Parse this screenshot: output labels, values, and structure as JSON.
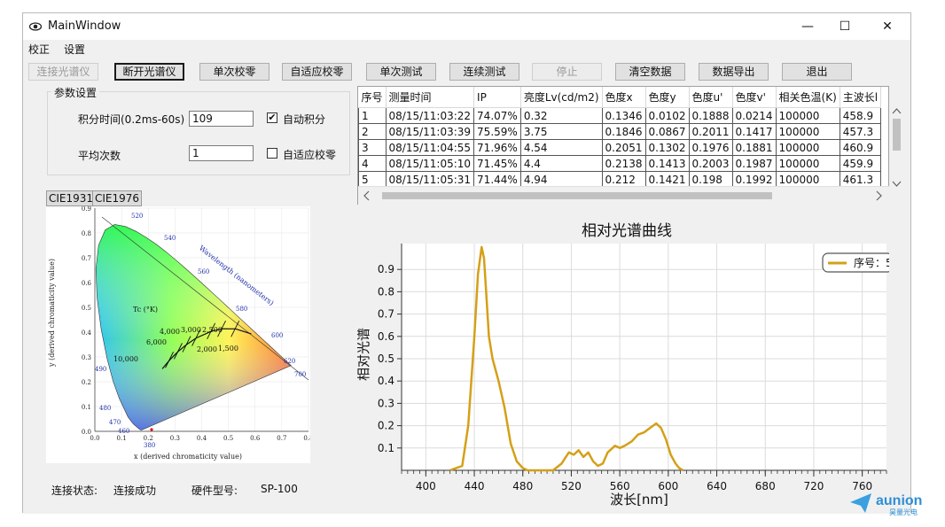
{
  "window": {
    "title": "MainWindow",
    "controls": {
      "minimize": "—",
      "maximize": "☐",
      "close": "✕"
    }
  },
  "menu": [
    "校正",
    "设置"
  ],
  "toolbar": [
    {
      "label": "连接光谱仪",
      "state": "disabled"
    },
    {
      "label": "断开光谱仪",
      "state": "primary"
    },
    {
      "label": "单次校零",
      "state": "normal"
    },
    {
      "label": "自适应校零",
      "state": "normal"
    },
    {
      "label": "单次测试",
      "state": "normal"
    },
    {
      "label": "连续测试",
      "state": "normal"
    },
    {
      "label": "停止",
      "state": "disabled"
    },
    {
      "label": "清空数据",
      "state": "normal"
    },
    {
      "label": "数据导出",
      "state": "normal"
    },
    {
      "label": "退出",
      "state": "normal"
    }
  ],
  "params": {
    "group_title": "参数设置",
    "integration_label": "积分时间(0.2ms-60s)",
    "integration_value": "109",
    "auto_integration_label": "自动积分",
    "auto_integration_checked": true,
    "average_label": "平均次数",
    "average_value": "1",
    "adaptive_zero_label": "自适应校零",
    "adaptive_zero_checked": false
  },
  "cie_tabs": [
    "CIE1931",
    "CIE1976"
  ],
  "cie_chart": {
    "ylabel": "y (derived chromaticity value)",
    "xlabel": "x (derived chromaticity value)",
    "x_ticks": [
      "0.0",
      "0.1",
      "0.2",
      "0.3",
      "0.4",
      "0.5",
      "0.6",
      "0.7",
      "0.8"
    ],
    "y_ticks": [
      "0.0",
      "0.1",
      "0.2",
      "0.3",
      "0.4",
      "0.5",
      "0.6",
      "0.7",
      "0.8",
      "0.9"
    ],
    "wavelength_label": "Wavelength (nanometers)",
    "tc_label": "Tc (°K)",
    "locus_labels": [
      "520",
      "540",
      "560",
      "580",
      "600",
      "620",
      "700",
      "490",
      "480",
      "470",
      "460",
      "380"
    ],
    "cct_labels": [
      "10,000",
      "6,000",
      "4,000",
      "3,000",
      "2,500",
      "2,000",
      "1,500"
    ]
  },
  "table": {
    "columns": [
      "序号",
      "测量时间",
      "IP",
      "亮度Lv(cd/m2)",
      "色度x",
      "色度y",
      "色度u'",
      "色度v'",
      "相关色温(K)",
      "主波长l"
    ],
    "rows": [
      [
        "1",
        "08/15/11:03:22",
        "74.07%",
        "0.32",
        "0.1346",
        "0.0102",
        "0.1888",
        "0.0214",
        "100000",
        "458.9"
      ],
      [
        "2",
        "08/15/11:03:39",
        "75.59%",
        "3.75",
        "0.1846",
        "0.0867",
        "0.2011",
        "0.1417",
        "100000",
        "457.3"
      ],
      [
        "3",
        "08/15/11:04:55",
        "71.96%",
        "4.54",
        "0.2051",
        "0.1302",
        "0.1976",
        "0.1881",
        "100000",
        "460.9"
      ],
      [
        "4",
        "08/15/11:05:10",
        "71.45%",
        "4.4",
        "0.2138",
        "0.1413",
        "0.2003",
        "0.1987",
        "100000",
        "459.9"
      ],
      [
        "5",
        "08/15/11:05:31",
        "71.44%",
        "4.94",
        "0.212",
        "0.1421",
        "0.198",
        "0.1992",
        "100000",
        "461.3"
      ]
    ]
  },
  "chart_data": {
    "type": "line",
    "title": "相对光谱曲线",
    "xlabel": "波长[nm]",
    "ylabel": "相对光谱",
    "xlim": [
      380,
      780
    ],
    "ylim": [
      0,
      1.0
    ],
    "x_ticks": [
      400,
      440,
      480,
      520,
      560,
      600,
      640,
      680,
      720,
      760
    ],
    "y_ticks": [
      0.1,
      0.2,
      0.3,
      0.4,
      0.5,
      0.6,
      0.7,
      0.8,
      0.9
    ],
    "legend": "top-right",
    "grid": true,
    "color": "#d4a017",
    "series": [
      {
        "name": "序号：5",
        "x": [
          420,
          430,
          435,
          440,
          443,
          446,
          448,
          450,
          452,
          455,
          460,
          465,
          470,
          475,
          480,
          484,
          487,
          505,
          512,
          518,
          522,
          526,
          530,
          534,
          538,
          542,
          546,
          550,
          556,
          560,
          564,
          570,
          575,
          580,
          585,
          590,
          594,
          598,
          602,
          606,
          609,
          612
        ],
        "y": [
          0,
          0.02,
          0.2,
          0.6,
          0.88,
          1.0,
          0.95,
          0.78,
          0.6,
          0.5,
          0.4,
          0.28,
          0.12,
          0.04,
          0.01,
          0,
          0,
          0,
          0.03,
          0.08,
          0.07,
          0.09,
          0.06,
          0.08,
          0.04,
          0.02,
          0.03,
          0.08,
          0.11,
          0.1,
          0.11,
          0.13,
          0.16,
          0.17,
          0.19,
          0.21,
          0.19,
          0.14,
          0.07,
          0.03,
          0.01,
          0
        ]
      }
    ]
  },
  "status": {
    "conn_label": "连接状态:",
    "conn_value": "连接成功",
    "hw_label": "硬件型号:",
    "hw_value": "SP-100"
  },
  "watermark": {
    "brand": "aunion",
    "sub": "昊量光电"
  }
}
